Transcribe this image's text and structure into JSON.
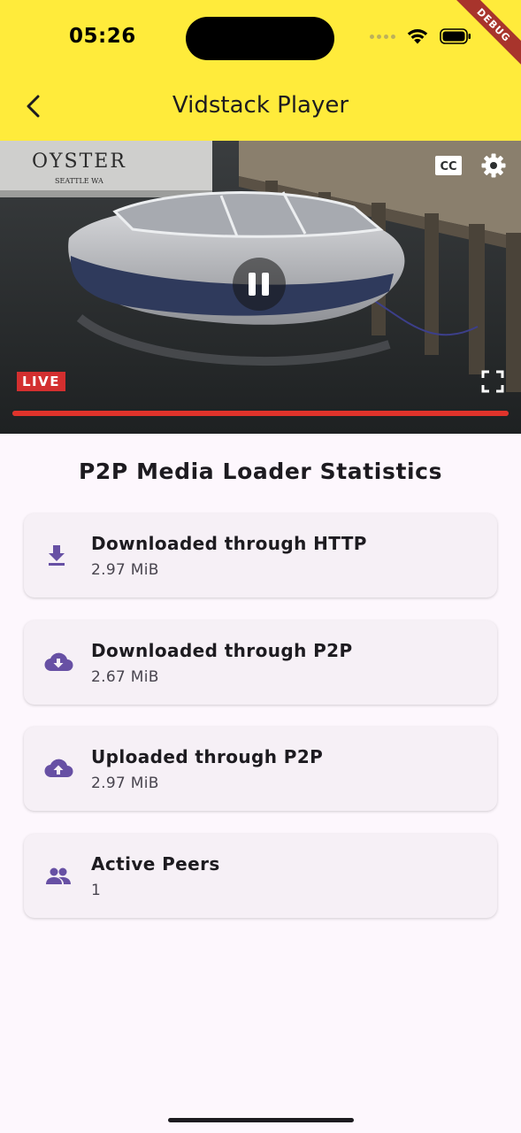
{
  "status_bar": {
    "time": "05:26",
    "debug_label": "DEBUG"
  },
  "app_bar": {
    "title": "Vidstack Player",
    "back_icon": "chevron-left-icon",
    "background_color": "#ffeb3b"
  },
  "player": {
    "live_label": "LIVE",
    "progress": 1.0,
    "progress_color": "#e0332b",
    "state": "playing",
    "controls": [
      "cc-icon",
      "settings-icon",
      "pause-icon",
      "fullscreen-icon"
    ]
  },
  "stats": {
    "title": "P2P Media Loader Statistics",
    "icon_color": "#6750a4",
    "items": [
      {
        "label": "Downloaded through HTTP",
        "value": "2.97 MiB",
        "icon": "download-icon"
      },
      {
        "label": "Downloaded through P2P",
        "value": "2.67 MiB",
        "icon": "cloud-download-icon"
      },
      {
        "label": "Uploaded through P2P",
        "value": "2.97 MiB",
        "icon": "cloud-upload-icon"
      },
      {
        "label": "Active Peers",
        "value": "1",
        "icon": "people-icon"
      }
    ]
  }
}
